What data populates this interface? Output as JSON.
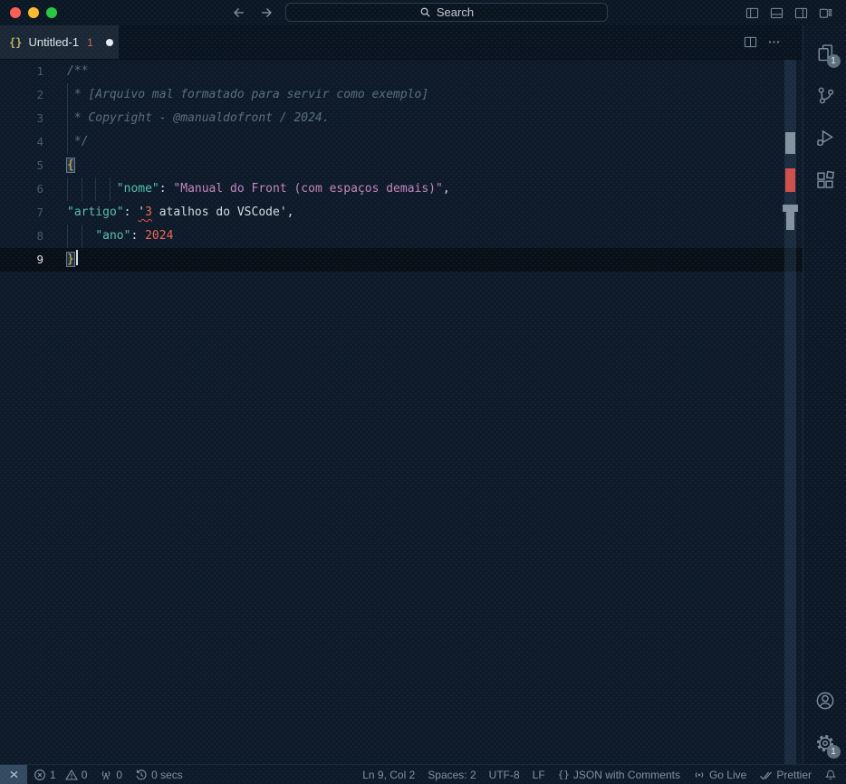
{
  "colors": {
    "bg": "#0d1826",
    "titlebar_bg": "#0c1724",
    "tabbar_bg": "#0a1420",
    "tab_active_bg": "#1b2734",
    "tab_text": "#dfe5ea",
    "editor_bg": "#0e1a28",
    "statusbar_bg": "#0d1a28",
    "remote_bg": "#344a61",
    "search_bg": "#0a141f",
    "search_border": "#2c3c4b",
    "traffic_red": "#ff5f57",
    "traffic_yellow": "#febc2e",
    "traffic_green": "#28c840",
    "badge_bg": "#5d6f80",
    "squiggle_red": "#f14c4c",
    "syntax_comment": "#5b6f7a",
    "syntax_key": "#59c0ab",
    "syntax_string": "#c586c0",
    "syntax_number": "#ee6a55",
    "syntax_brace": "#e2c25b",
    "syntax_default": "#d6dce2",
    "line_number": "#47596a",
    "line_number_active": "#dbe2e8",
    "ui_text": "#8290a0",
    "icon": "#7e8c9a",
    "guide": "#22364a"
  },
  "titlebar": {
    "search_label": "Search"
  },
  "tabbar": {
    "tabs": [
      {
        "icon_glyph": "{}",
        "label": "Untitled-1",
        "error_count": "1",
        "modified": true
      }
    ]
  },
  "editor": {
    "lines": [
      {
        "num": "1",
        "guides": [],
        "tokens": [
          {
            "text": "/**",
            "type": "comment"
          }
        ]
      },
      {
        "num": "2",
        "guides": [
          0
        ],
        "tokens": [
          {
            "text": " * [Arquivo mal formatado para servir como exemplo]",
            "type": "comment"
          }
        ]
      },
      {
        "num": "3",
        "guides": [
          0
        ],
        "tokens": [
          {
            "text": " * Copyright - @manualdofront / 2024.",
            "type": "comment"
          }
        ]
      },
      {
        "num": "4",
        "guides": [
          0
        ],
        "tokens": [
          {
            "text": " */",
            "type": "comment"
          }
        ]
      },
      {
        "num": "5",
        "guides": [],
        "tokens": [
          {
            "text": "{",
            "type": "brace match"
          }
        ]
      },
      {
        "num": "6",
        "guides": [
          0,
          2,
          4,
          6
        ],
        "tokens": [
          {
            "text": "       ",
            "type": "default"
          },
          {
            "text": "\"nome\"",
            "type": "key"
          },
          {
            "text": ": ",
            "type": "default"
          },
          {
            "text": "\"Manual do Front (com espaços demais)\"",
            "type": "string"
          },
          {
            "text": ",",
            "type": "default"
          }
        ]
      },
      {
        "num": "7",
        "guides": [],
        "tokens": [
          {
            "text": "\"artigo\"",
            "type": "key"
          },
          {
            "text": ": ",
            "type": "default"
          },
          {
            "text": "'",
            "type": "default",
            "squiggle": true
          },
          {
            "text": "3",
            "type": "error",
            "squiggle": true
          },
          {
            "text": " atalhos do VSCode'",
            "type": "default"
          },
          {
            "text": ",",
            "type": "default"
          }
        ]
      },
      {
        "num": "8",
        "guides": [
          0,
          2
        ],
        "tokens": [
          {
            "text": "    ",
            "type": "default"
          },
          {
            "text": "\"ano\"",
            "type": "key"
          },
          {
            "text": ": ",
            "type": "default"
          },
          {
            "text": "2024",
            "type": "number"
          }
        ]
      },
      {
        "num": "9",
        "guides": [],
        "current": true,
        "cursor": true,
        "tokens": [
          {
            "text": "}",
            "type": "brace match"
          }
        ]
      }
    ]
  },
  "activitybar": {
    "top": [
      {
        "name": "explorer",
        "badge": "1"
      },
      {
        "name": "source-control"
      },
      {
        "name": "run-and-debug"
      },
      {
        "name": "extensions"
      }
    ],
    "bottom": [
      {
        "name": "accounts"
      },
      {
        "name": "settings",
        "badge": "1"
      }
    ]
  },
  "statusbar": {
    "problems": {
      "errors": "1",
      "warnings": "0"
    },
    "ports": "0",
    "timer": "0 secs",
    "cursor_position": "Ln 9, Col 2",
    "indentation": "Spaces: 2",
    "encoding": "UTF-8",
    "eol": "LF",
    "language_icon_glyph": "{}",
    "language": "JSON with Comments",
    "go_live": "Go Live",
    "formatter": "Prettier"
  }
}
